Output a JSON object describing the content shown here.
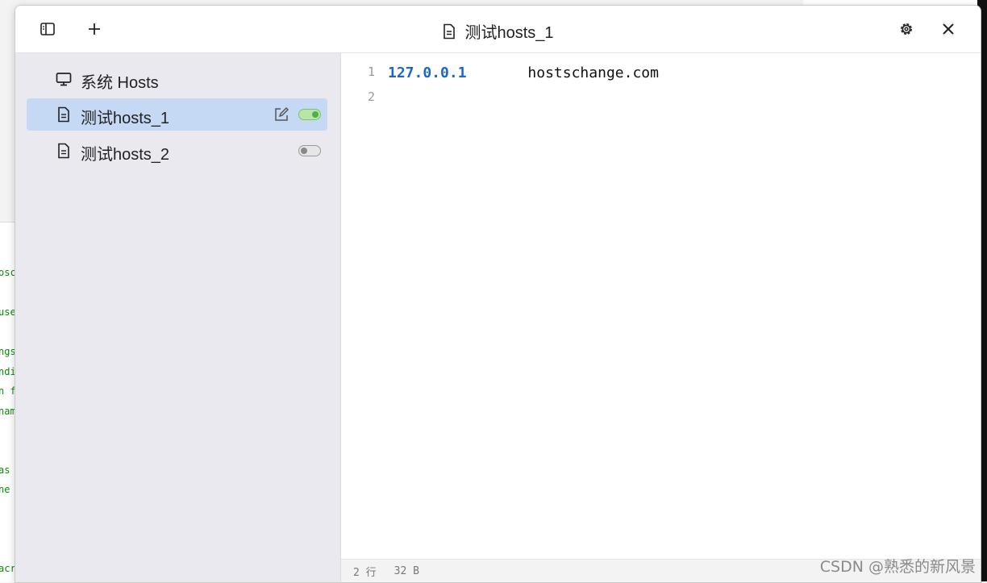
{
  "window": {
    "title": "测试hosts_1"
  },
  "sidebar": {
    "items": [
      {
        "label": "系统 Hosts",
        "icon": "monitor-icon",
        "active": false
      },
      {
        "label": "测试hosts_1",
        "icon": "document-icon",
        "active": true,
        "enabled": true
      },
      {
        "label": "测试hosts_2",
        "icon": "document-icon",
        "active": false,
        "enabled": false
      }
    ]
  },
  "editor": {
    "lines": [
      {
        "number": "1",
        "ip": "127.0.0.1",
        "host": "hostschange.com"
      },
      {
        "number": "2",
        "ip": "",
        "host": ""
      }
    ]
  },
  "status": {
    "lines": "2 行",
    "size": "32 B"
  },
  "watermark": "CSDN @熟悉的新风景",
  "colors": {
    "sidebar_bg": "#ebe9f0",
    "active_item_bg": "#c5d9f4",
    "ip_color": "#1a67c8",
    "toggle_on": "#4caf50"
  }
}
